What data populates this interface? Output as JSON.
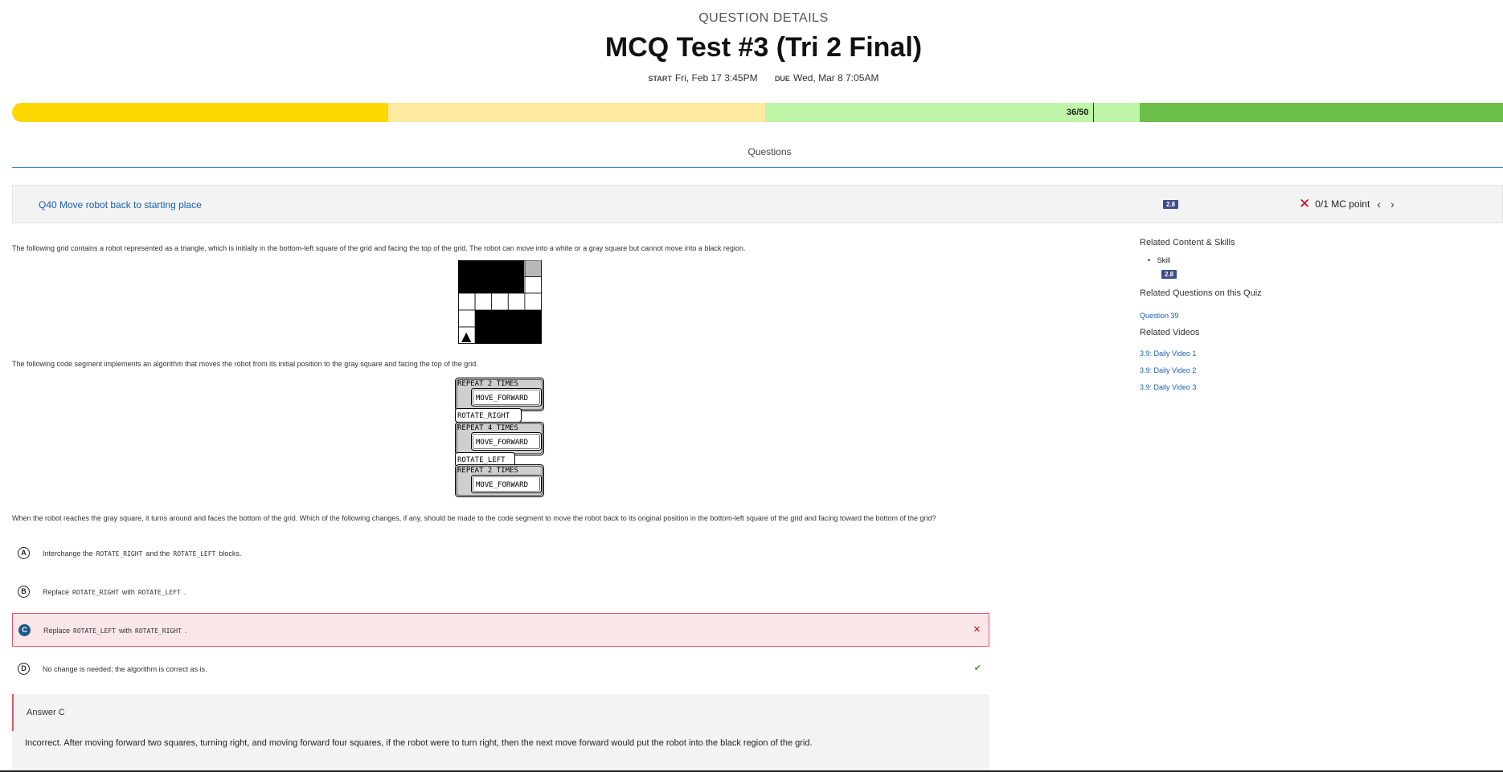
{
  "header": {
    "subtitle": "QUESTION DETAILS",
    "title": "MCQ Test #3 (Tri 2 Final)",
    "start_label": "START",
    "start_value": "Fri, Feb 17 3:45PM",
    "due_label": "DUE",
    "due_value": "Wed, Mar 8 7:05AM"
  },
  "progress": {
    "label": "36/50",
    "score": 36,
    "total": 50,
    "colors": [
      "#fdd800",
      "#fde9a0",
      "#bff5a8",
      "#6cc04a"
    ]
  },
  "tabs": {
    "questions": "Questions"
  },
  "question": {
    "title": "Q40 Move robot back to starting place",
    "skill_badge": "2.8",
    "score_text": "0/1 MC point",
    "intro": "The following grid contains a robot represented as a triangle, which is initially in the bottom-left square of the grid and facing the top of the grid. The robot can move into a white or a gray square but cannot move into a black region.",
    "code_intro": "The following code segment implements an algorithm that moves the robot from its initial position to the gray square and facing the top of the grid.",
    "prompt": "When the robot reaches the gray square, it turns around and faces the bottom of the grid. Which of the following changes, if any, should be made to the code segment to move the robot back to its original position in the bottom-left square of the grid and facing toward the bottom of the grid?",
    "robot_glyph": "▲",
    "code_blocks": {
      "repeat_a": "REPEAT 2 TIMES",
      "move_a": "MOVE_FORWARD",
      "rotate_right": "ROTATE_RIGHT",
      "repeat_b": "REPEAT 4 TIMES",
      "move_b": "MOVE_FORWARD",
      "rotate_left": "ROTATE_LEFT",
      "repeat_c": "REPEAT 2 TIMES",
      "move_c": "MOVE_FORWARD"
    },
    "choices": [
      {
        "letter": "A",
        "pre": "Interchange the",
        "code1": "ROTATE_RIGHT",
        "mid": "and the",
        "code2": "ROTATE_LEFT",
        "post": "blocks."
      },
      {
        "letter": "B",
        "pre": "Replace",
        "code1": "ROTATE_RIGHT",
        "mid": "with",
        "code2": "ROTATE_LEFT",
        "post": "."
      },
      {
        "letter": "C",
        "pre": "Replace",
        "code1": "ROTATE_LEFT",
        "mid": "with",
        "code2": "ROTATE_RIGHT",
        "post": "."
      },
      {
        "letter": "D",
        "text": "No change is needed; the algorithm is correct as is."
      }
    ],
    "selected_mark": "✕",
    "correct_mark": "✔",
    "answer_title": "Answer C",
    "answer_body": "Incorrect. After moving forward two squares, turning right, and moving forward four squares, if the robot were to turn right, then the next move forward would put the robot into the black region of the grid."
  },
  "sidebar": {
    "related_heading": "Related Content & Skills",
    "skill_label": "Skill",
    "skill_badge": "2.8",
    "related_questions_heading": "Related Questions on this Quiz",
    "related_question": "Question 39",
    "related_videos_heading": "Related Videos",
    "videos": [
      "3.9: Daily Video 1",
      "3.9: Daily Video 2",
      "3.9: Daily Video 3"
    ]
  }
}
